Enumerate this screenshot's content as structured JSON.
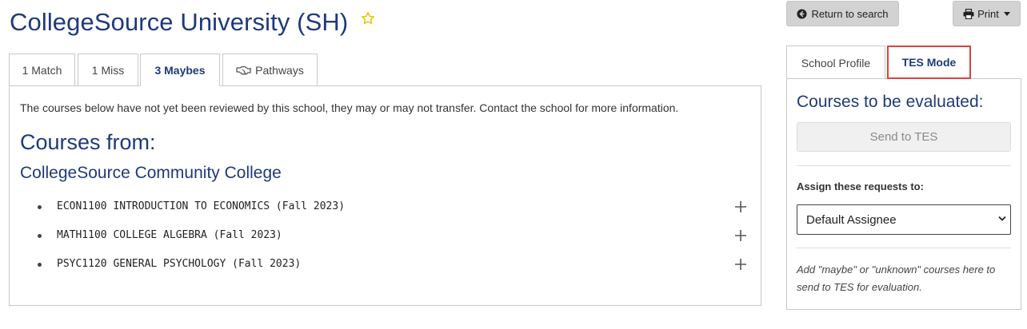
{
  "header": {
    "school_title": "CollegeSource University (SH)"
  },
  "tabs": [
    {
      "label": "1 Match"
    },
    {
      "label": "1 Miss"
    },
    {
      "label": "3 Maybes"
    },
    {
      "label": "Pathways"
    }
  ],
  "main": {
    "note": "The courses below have not yet been reviewed by this school, they may or may not transfer. Contact the school for more information.",
    "courses_from": "Courses from:",
    "college_name": "CollegeSource Community College",
    "courses": [
      {
        "text": "ECON1100 INTRODUCTION TO ECONOMICS (Fall 2023)"
      },
      {
        "text": "MATH1100 COLLEGE ALGEBRA (Fall 2023)"
      },
      {
        "text": "PSYC1120 GENERAL PSYCHOLOGY (Fall 2023)"
      }
    ]
  },
  "toolbar": {
    "return_label": "Return to search",
    "print_label": "Print"
  },
  "sidebar": {
    "tab_profile": "School Profile",
    "tab_tes": "TES Mode",
    "eval_title": "Courses to be evaluated:",
    "send_label": "Send to TES",
    "assign_label": "Assign these requests to:",
    "assign_value": "Default Assignee",
    "help_text": "Add \"maybe\" or \"unknown\" courses here to send to TES for evaluation."
  },
  "colors": {
    "brand_blue": "#1f3a7a",
    "highlight_red": "#e0403a",
    "star_yellow": "#e8c200"
  }
}
